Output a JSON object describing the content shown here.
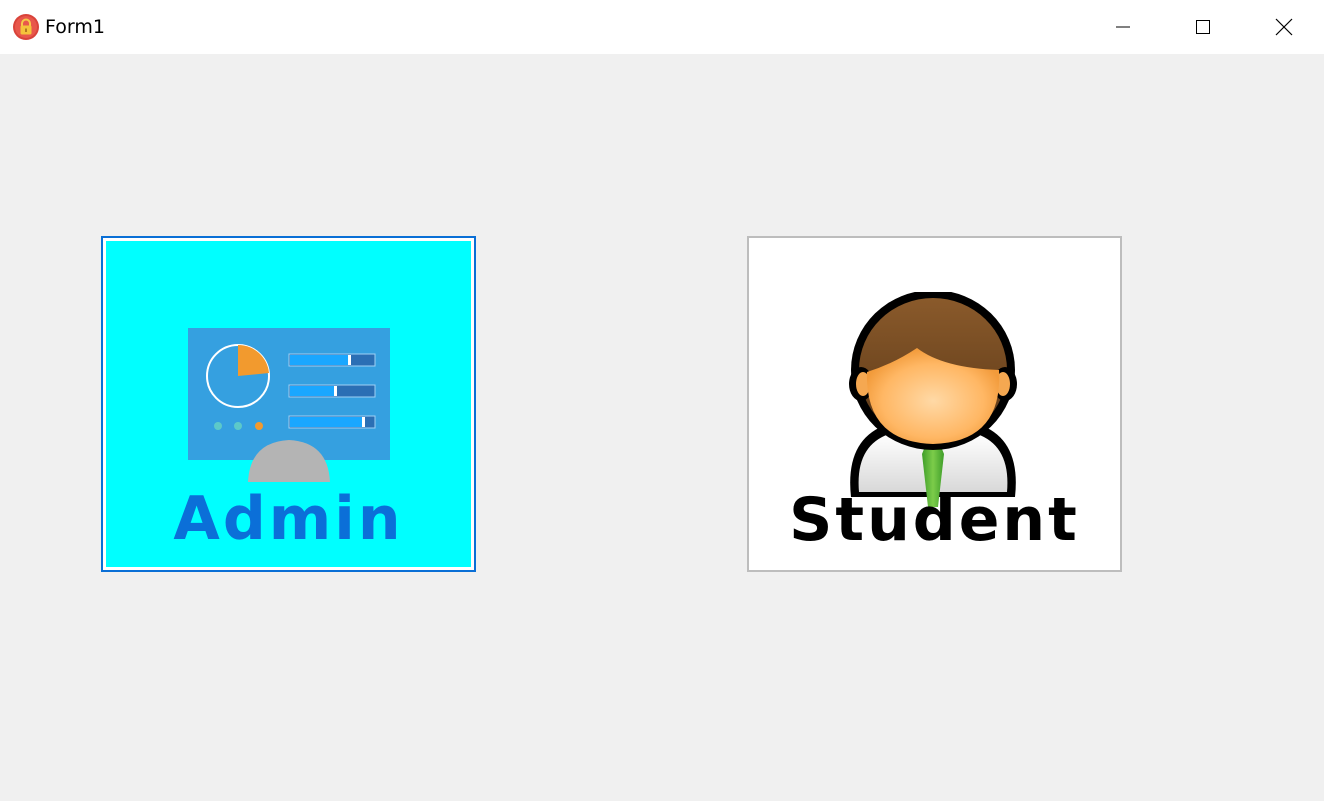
{
  "window": {
    "title": "Form1",
    "app_icon": "lock-icon",
    "controls": {
      "minimize_icon": "minimize-icon",
      "maximize_icon": "maximize-icon",
      "close_icon": "close-icon"
    }
  },
  "tiles": {
    "admin": {
      "label": "Admin",
      "icon": "dashboard-monitor-icon",
      "background_color": "#00ffff",
      "label_color": "#0b6fd8"
    },
    "student": {
      "label": "Student",
      "icon": "student-avatar-icon",
      "background_color": "#ffffff",
      "label_color": "#000000"
    }
  }
}
